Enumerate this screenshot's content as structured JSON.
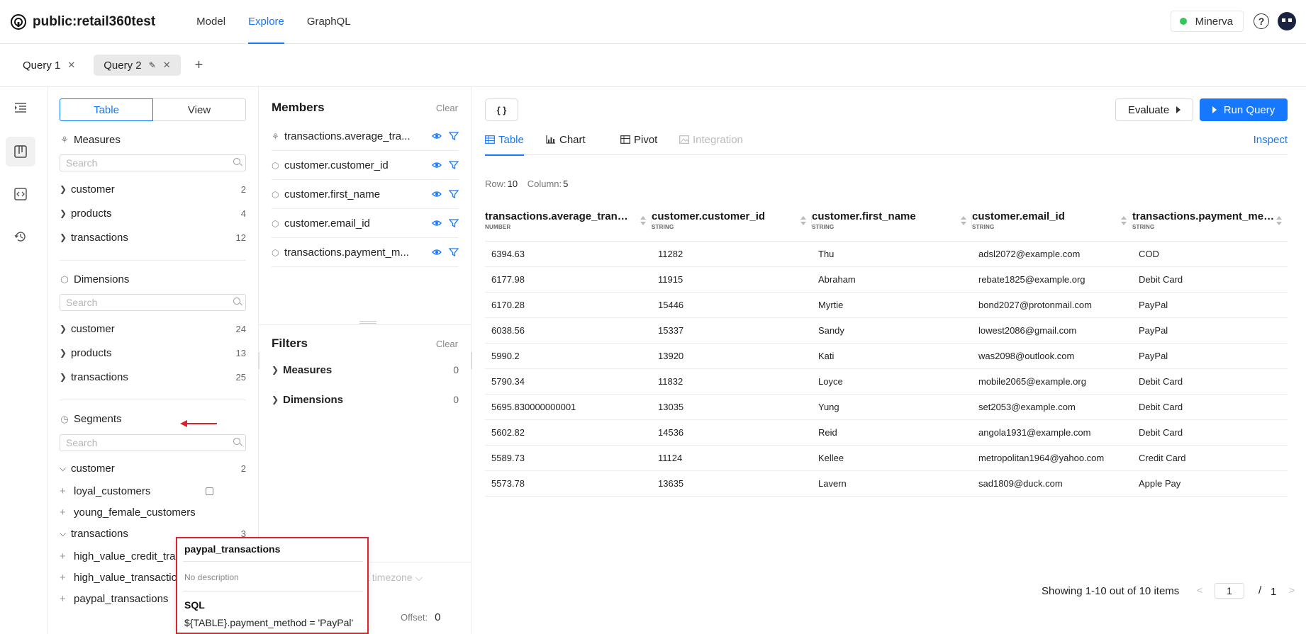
{
  "app": {
    "title": "public:retail360test"
  },
  "nav": {
    "items": [
      "Model",
      "Explore",
      "GraphQL"
    ],
    "active": "Explore"
  },
  "header": {
    "status_label": "Minerva",
    "status_color": "#34c759",
    "help_label": "?"
  },
  "query_tabs": {
    "tabs": [
      "Query 1",
      "Query 2"
    ],
    "active": "Query 2",
    "add_label": "+"
  },
  "explorer": {
    "toggle": {
      "table_label": "Table",
      "view_label": "View"
    },
    "measures": {
      "title": "Measures",
      "search_placeholder": "Search",
      "groups": [
        {
          "label": "customer",
          "count": "2"
        },
        {
          "label": "products",
          "count": "4"
        },
        {
          "label": "transactions",
          "count": "12"
        }
      ]
    },
    "dimensions": {
      "title": "Dimensions",
      "search_placeholder": "Search",
      "groups": [
        {
          "label": "customer",
          "count": "24"
        },
        {
          "label": "products",
          "count": "13"
        },
        {
          "label": "transactions",
          "count": "25"
        }
      ]
    },
    "segments": {
      "title": "Segments",
      "search_placeholder": "Search",
      "customer": {
        "label": "customer",
        "count": "2",
        "items": [
          "loyal_customers",
          "young_female_customers"
        ]
      },
      "transactions": {
        "label": "transactions",
        "count": "3",
        "items": [
          "high_value_credit_tran",
          "high_value_transactio",
          "paypal_transactions"
        ]
      }
    }
  },
  "members": {
    "title": "Members",
    "clear_label": "Clear",
    "items": [
      "transactions.average_tra...",
      "customer.customer_id",
      "customer.first_name",
      "customer.email_id",
      "transactions.payment_m..."
    ]
  },
  "filters": {
    "title": "Filters",
    "clear_label": "Clear",
    "measures": {
      "label": "Measures",
      "count": "0"
    },
    "dimensions": {
      "label": "Dimensions",
      "count": "0"
    }
  },
  "bottom": {
    "timezone_text": "t timezone",
    "offset_label": "Offset:",
    "offset_value": "0"
  },
  "popover": {
    "title": "paypal_transactions",
    "description": "No description",
    "sql_heading": "SQL",
    "sql": "${TABLE}.payment_method = 'PayPal'"
  },
  "results": {
    "braces_label": "{ }",
    "evaluate_label": "Evaluate",
    "run_label": "Run Query",
    "tabs": [
      "Table",
      "Chart",
      "Pivot",
      "Integration"
    ],
    "active_tab": "Table",
    "inspect_label": "Inspect",
    "row_label": "Row:",
    "row_value": "10",
    "col_label": "Column:",
    "col_value": "5",
    "columns": [
      {
        "name": "transactions.average_trans...",
        "type": "NUMBER"
      },
      {
        "name": "customer.customer_id",
        "type": "STRING"
      },
      {
        "name": "customer.first_name",
        "type": "STRING"
      },
      {
        "name": "customer.email_id",
        "type": "STRING"
      },
      {
        "name": "transactions.payment_meth...",
        "type": "STRING"
      }
    ],
    "rows": [
      [
        "6394.63",
        "11282",
        "Thu",
        "adsl2072@example.com",
        "COD"
      ],
      [
        "6177.98",
        "11915",
        "Abraham",
        "rebate1825@example.org",
        "Debit Card"
      ],
      [
        "6170.28",
        "15446",
        "Myrtie",
        "bond2027@protonmail.com",
        "PayPal"
      ],
      [
        "6038.56",
        "15337",
        "Sandy",
        "lowest2086@gmail.com",
        "PayPal"
      ],
      [
        "5990.2",
        "13920",
        "Kati",
        "was2098@outlook.com",
        "PayPal"
      ],
      [
        "5790.34",
        "11832",
        "Loyce",
        "mobile2065@example.org",
        "Debit Card"
      ],
      [
        "5695.830000000001",
        "13035",
        "Yung",
        "set2053@example.com",
        "Debit Card"
      ],
      [
        "5602.82",
        "14536",
        "Reid",
        "angola1931@example.com",
        "Debit Card"
      ],
      [
        "5589.73",
        "11124",
        "Kellee",
        "metropolitan1964@yahoo.com",
        "Credit Card"
      ],
      [
        "5573.78",
        "13635",
        "Lavern",
        "sad1809@duck.com",
        "Apple Pay"
      ]
    ],
    "pagination": {
      "showing": "Showing 1-10 out of 10 items",
      "page": "1",
      "slash": "/",
      "total": "1"
    }
  },
  "colors": {
    "accent": "#1677ff",
    "highlight": "#e0202a"
  }
}
